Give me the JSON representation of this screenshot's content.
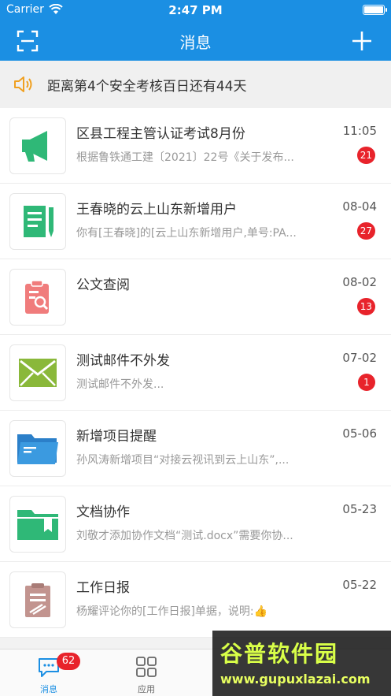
{
  "status_bar": {
    "carrier": "Carrier",
    "time": "2:47 PM"
  },
  "navbar": {
    "title": "消息",
    "scan_icon": "scan-icon",
    "add_icon": "plus-icon"
  },
  "notice": {
    "text": "距离第4个安全考核百日还有44天",
    "icon": "speaker-icon"
  },
  "messages": [
    {
      "title": "区县工程主管认证考试8月份",
      "subtitle": "根据鲁铁通工建〔2021〕22号《关于发布...",
      "time": "11:05",
      "badge": "21",
      "icon": "megaphone-icon",
      "color": "#2fb877"
    },
    {
      "title": "王春晓的云上山东新增用户",
      "subtitle": "你有[王春晓]的[云上山东新增用户,单号:PA...",
      "time": "08-04",
      "badge": "27",
      "icon": "document-pen-icon",
      "color": "#2fb877"
    },
    {
      "title": "公文查阅",
      "subtitle": "",
      "time": "08-02",
      "badge": "13",
      "icon": "clipboard-search-icon",
      "color": "#f07c7c"
    },
    {
      "title": "测试邮件不外发",
      "subtitle": "测试邮件不外发...",
      "time": "07-02",
      "badge": "1",
      "icon": "envelope-icon",
      "color": "#8ab83a"
    },
    {
      "title": "新增项目提醒",
      "subtitle": "孙风涛新增项目“对接云视讯到云上山东”,...",
      "time": "05-06",
      "badge": "",
      "icon": "folder-icon",
      "color": "#3b9ae0"
    },
    {
      "title": "文档协作",
      "subtitle": "刘敬才添加协作文档“测试.docx”需要你协...",
      "time": "05-23",
      "badge": "",
      "icon": "folder-bookmark-icon",
      "color": "#2fb877"
    },
    {
      "title": "工作日报",
      "subtitle": "杨耀评论你的[工作日报]单据，说明:👍",
      "time": "05-22",
      "badge": "",
      "icon": "report-clipboard-icon",
      "color": "#c2948f"
    }
  ],
  "tabbar": {
    "tabs": [
      {
        "label": "消息",
        "badge": "62",
        "icon": "chat-icon",
        "active": true
      },
      {
        "label": "应用",
        "badge": "",
        "icon": "apps-grid-icon",
        "active": false
      }
    ]
  },
  "watermark": {
    "main": "谷普软件园",
    "url": "www.gupuxlazai.com"
  },
  "colors": {
    "primary": "#1b8fe3",
    "badge": "#e8232b"
  }
}
